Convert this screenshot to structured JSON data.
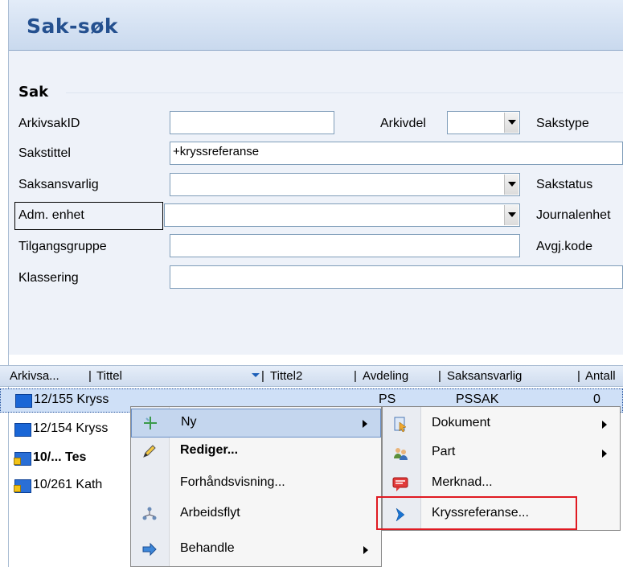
{
  "window": {
    "title": "Sak-søk"
  },
  "form": {
    "section_title": "Sak",
    "arkivsakid_label": "ArkivsakID",
    "arkivsakid_value": "",
    "arkivdel_label": "Arkivdel",
    "arkivdel_value": "",
    "sakstype_label": "Sakstype",
    "sakstittel_label": "Sakstittel",
    "sakstittel_value": "+kryssreferanse",
    "saksansvarlig_label": "Saksansvarlig",
    "sakstatus_label": "Sakstatus",
    "adm_enhet_label": "Adm. enhet",
    "journalenhet_label": "Journalenhet",
    "tilgangsgruppe_label": "Tilgangsgruppe",
    "avgj_kode_label": "Avgj.kode",
    "klassering_label": "Klassering"
  },
  "grid": {
    "columns": [
      "Arkivsa...",
      "Tittel",
      "Tittel2",
      "Avdeling",
      "Saksansvarlig",
      "Antall"
    ],
    "rows": [
      {
        "id": "12/155",
        "title": "Kryss",
        "avdeling": "PS",
        "saksansvarlig": "PSSAK",
        "antall": "0"
      },
      {
        "id": "12/154",
        "title": "Kryss"
      },
      {
        "id": "10/...",
        "title": "Tes"
      },
      {
        "id": "10/261",
        "title": "Kath"
      }
    ]
  },
  "context_menu": {
    "items": [
      {
        "label": "Ny",
        "icon": "new-icon",
        "submenu": true
      },
      {
        "label": "Rediger...",
        "icon": "pencil-icon",
        "bold": true
      },
      {
        "label": "Forhåndsvisning...",
        "icon": ""
      },
      {
        "label": "Arbeidsflyt",
        "icon": "workflow-icon"
      },
      {
        "label": "Behandle",
        "icon": "process-arrow-icon",
        "submenu": true
      }
    ]
  },
  "submenu": {
    "items": [
      {
        "label": "Dokument",
        "icon": "document-icon",
        "submenu": true
      },
      {
        "label": "Part",
        "icon": "people-icon",
        "submenu": true
      },
      {
        "label": "Merknad...",
        "icon": "comment-icon"
      },
      {
        "label": "Kryssreferanse...",
        "icon": "chevron-right-icon"
      }
    ]
  },
  "colors": {
    "title": "#24508f",
    "highlight": "#e01a22"
  }
}
